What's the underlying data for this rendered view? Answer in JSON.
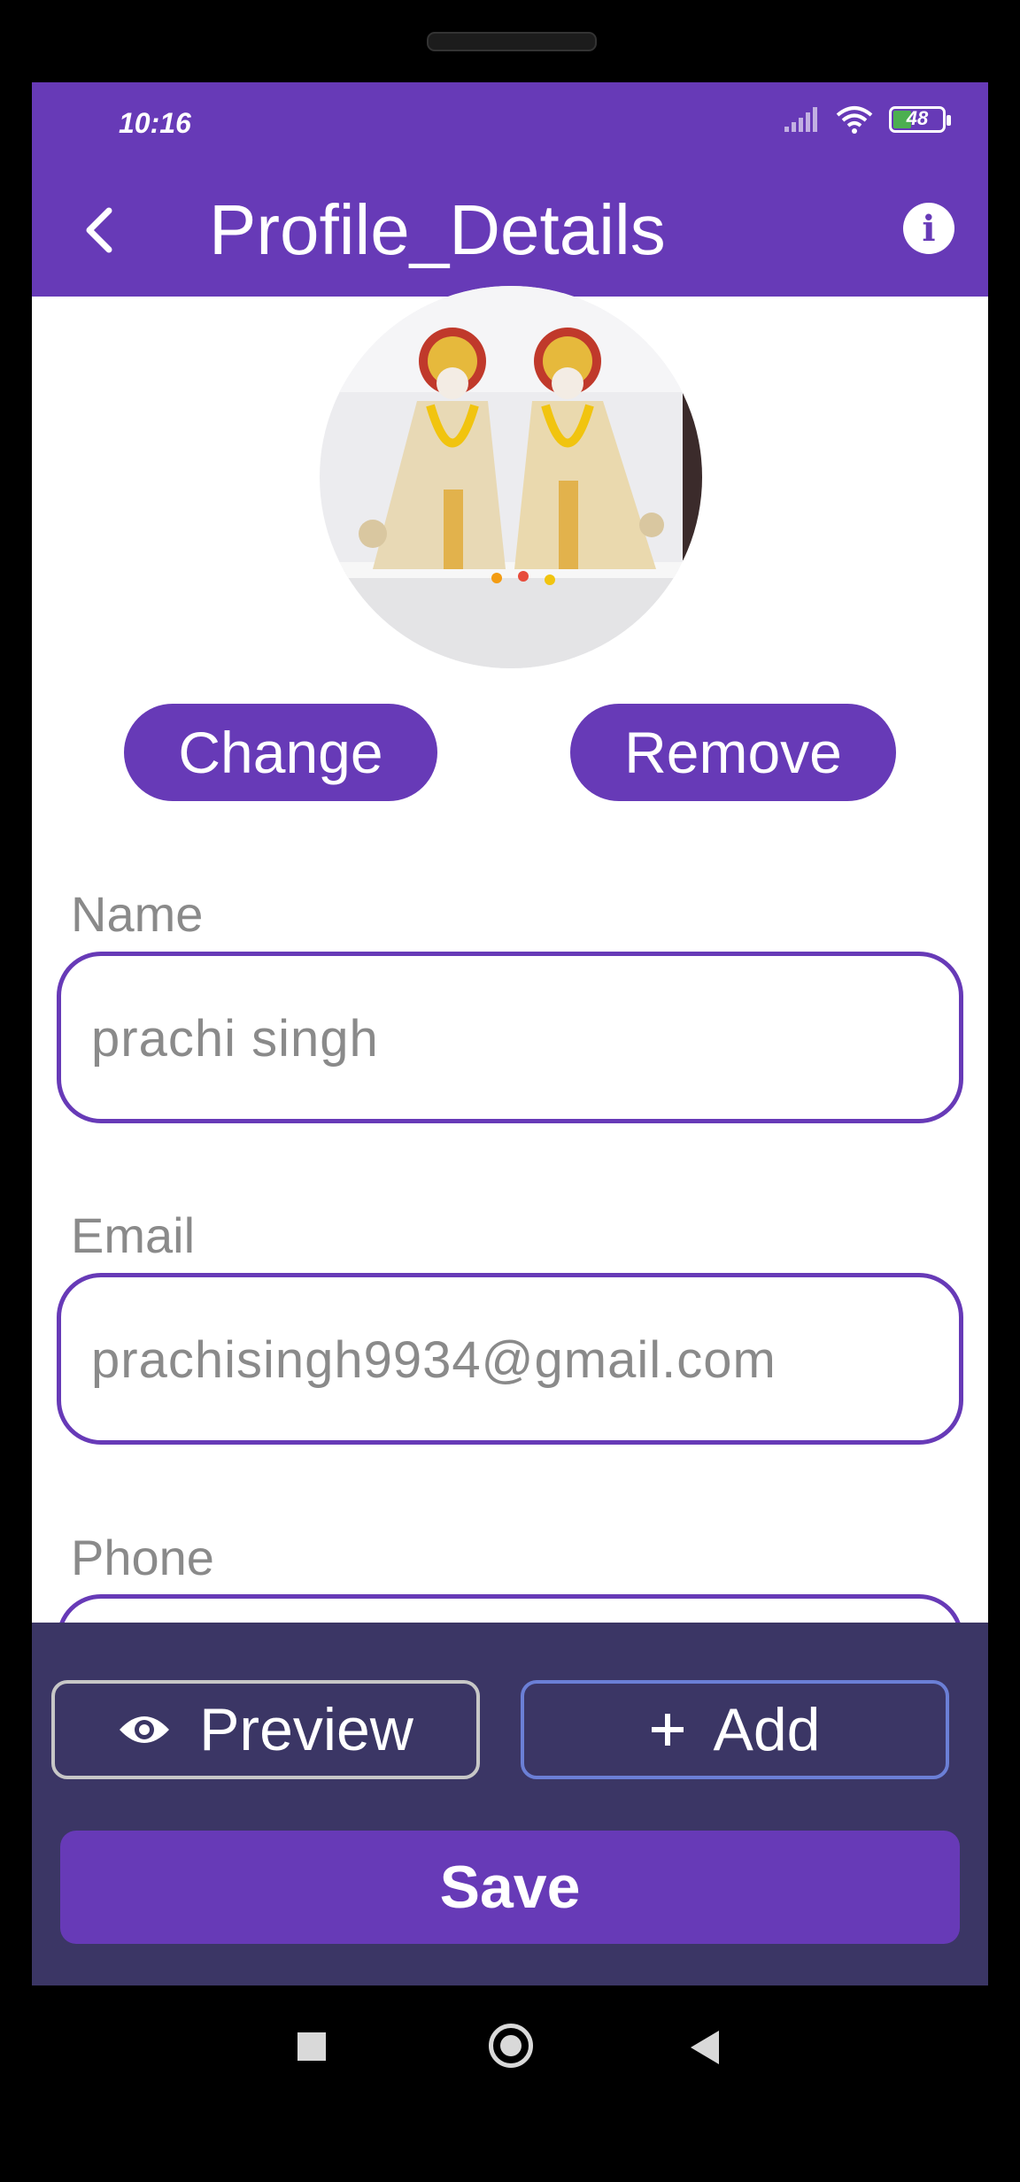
{
  "status": {
    "time": "10:16",
    "battery": "48"
  },
  "appbar": {
    "title": "Profile_Details"
  },
  "profile": {
    "change_label": "Change",
    "remove_label": "Remove"
  },
  "form": {
    "name_label": "Name",
    "name_value": "prachi singh",
    "email_label": "Email",
    "email_value": "prachisingh9934@gmail.com",
    "phone_label": "Phone"
  },
  "actions": {
    "preview_label": "Preview",
    "add_label": "Add",
    "save_label": "Save"
  },
  "icons": {
    "back": "chevron-left-icon",
    "info": "info-icon",
    "preview": "eye-icon",
    "add": "plus-icon"
  },
  "colors": {
    "primary": "#673ab7",
    "bottom_panel": "#3b3665",
    "field_text": "#8a8a8a",
    "add_border": "#6b7fd6"
  }
}
